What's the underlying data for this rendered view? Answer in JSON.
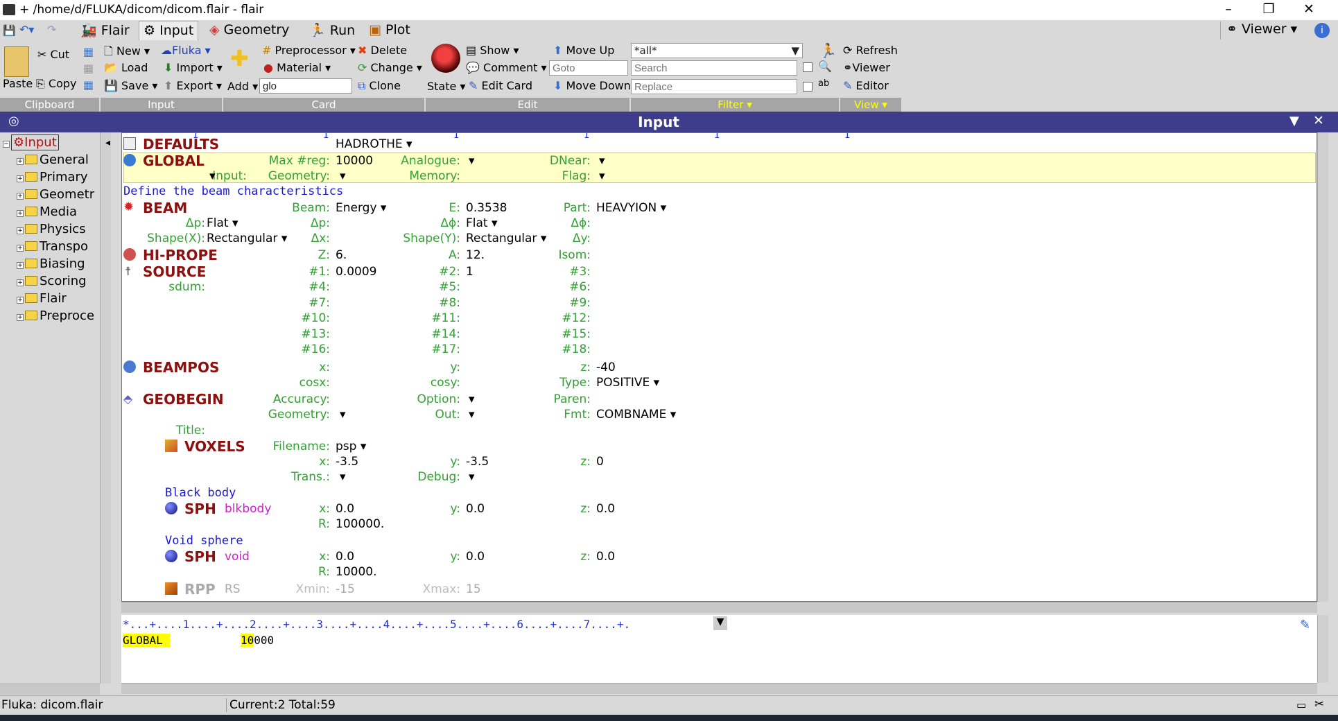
{
  "window": {
    "title": "+ /home/d/FLUKA/dicom/dicom.flair - flair"
  },
  "tabs": [
    {
      "label": "Flair"
    },
    {
      "label": "Input"
    },
    {
      "label": "Geometry"
    },
    {
      "label": "Run"
    },
    {
      "label": "Plot"
    }
  ],
  "viewer_menu": "Viewer",
  "ribbon": {
    "clipboard": {
      "cut": "Cut",
      "paste": "Paste",
      "copy": "Copy",
      "group": "Clipboard"
    },
    "input": {
      "new": "New",
      "load": "Load",
      "save": "Save",
      "fluka": "Fluka",
      "import": "Import",
      "export": "Export",
      "group": "Input"
    },
    "card": {
      "add": "Add",
      "add_value": "glo",
      "preprocessor": "Preprocessor",
      "material": "Material",
      "delete": "Delete",
      "change": "Change",
      "clone": "Clone",
      "group": "Card"
    },
    "edit": {
      "state": "State",
      "show": "Show",
      "comment": "Comment",
      "edit_card": "Edit Card",
      "move_up": "Move Up",
      "move_down": "Move Down",
      "goto_placeholder": "Goto",
      "group": "Edit"
    },
    "filter": {
      "select_value": "*all*",
      "search_placeholder": "Search",
      "replace_placeholder": "Replace",
      "group": "Filter"
    },
    "view": {
      "refresh": "Refresh",
      "viewer": "Viewer",
      "editor": "Editor",
      "group": "View"
    }
  },
  "panel": {
    "title": "Input"
  },
  "tree": {
    "root": "Input",
    "items": [
      "General",
      "Primary",
      "Geometr",
      "Media",
      "Physics",
      "Transpo",
      "Biasing",
      "Scoring",
      "Flair",
      "Preproce"
    ]
  },
  "ruler_top": [
    "1",
    "1",
    "1",
    "1",
    "1",
    "1"
  ],
  "cards": {
    "defaults": {
      "name": "DEFAULTS",
      "value": "HADROTHE"
    },
    "global": {
      "name": "GLOBAL",
      "maxreg_l": "Max #reg:",
      "maxreg": "10000",
      "analogue_l": "Analogue:",
      "dnear_l": "DNear:",
      "input_l": "Input:",
      "geometry_l": "Geometry:",
      "memory_l": "Memory:",
      "flag_l": "Flag:"
    },
    "beam_comment": "Define the beam characteristics",
    "beam": {
      "name": "BEAM",
      "beam_l": "Beam:",
      "beam": "Energy",
      "e_l": "E:",
      "e": "0.3538",
      "part_l": "Part:",
      "part": "HEAVYION",
      "dp_l": "Δp:",
      "dp": "Flat",
      "dphi_l": "Δϕ:",
      "dphi": "Flat",
      "dp_top_l": "Δp:",
      "dphi_top_l": "Δϕ:",
      "shapex_l": "Shape(X):",
      "shapex": "Rectangular",
      "shapey_l": "Shape(Y):",
      "shapey": "Rectangular",
      "dx_l": "Δx:",
      "dy_l": "Δy:"
    },
    "hiprope": {
      "name": "HI-PROPE",
      "z_l": "Z:",
      "z": "6.",
      "a_l": "A:",
      "a": "12.",
      "isom_l": "Isom:"
    },
    "source": {
      "name": "SOURCE",
      "sdum_l": "sdum:",
      "p1_l": "#1:",
      "p1": "0.0009",
      "p2_l": "#2:",
      "p2": "1",
      "p3_l": "#3:",
      "p4_l": "#4:",
      "p5_l": "#5:",
      "p6_l": "#6:",
      "p7_l": "#7:",
      "p8_l": "#8:",
      "p9_l": "#9:",
      "p10_l": "#10:",
      "p11_l": "#11:",
      "p12_l": "#12:",
      "p13_l": "#13:",
      "p14_l": "#14:",
      "p15_l": "#15:",
      "p16_l": "#16:",
      "p17_l": "#17:",
      "p18_l": "#18:"
    },
    "beampos": {
      "name": "BEAMPOS",
      "x_l": "x:",
      "y_l": "y:",
      "z_l": "z:",
      "z": "-40",
      "cosx_l": "cosx:",
      "cosy_l": "cosy:",
      "type_l": "Type:",
      "type": "POSITIVE"
    },
    "geobegin": {
      "name": "GEOBEGIN",
      "accuracy_l": "Accuracy:",
      "option_l": "Option:",
      "paren_l": "Paren:",
      "geometry_l": "Geometry:",
      "out_l": "Out:",
      "fmt_l": "Fmt:",
      "fmt": "COMBNAME"
    },
    "title_l": "Title:",
    "voxels": {
      "name": "VOXELS",
      "filename_l": "Filename:",
      "filename": "psp",
      "x_l": "x:",
      "x": "-3.5",
      "y_l": "y:",
      "y": "-3.5",
      "z_l": "z:",
      "z": "0",
      "trans_l": "Trans.:",
      "debug_l": "Debug:"
    },
    "blkbody_comment": "Black body",
    "sph1": {
      "name": "SPH",
      "id": "blkbody",
      "x_l": "x:",
      "x": "0.0",
      "y_l": "y:",
      "y": "0.0",
      "z_l": "z:",
      "z": "0.0",
      "r_l": "R:",
      "r": "100000."
    },
    "void_comment": "Void sphere",
    "sph2": {
      "name": "SPH",
      "id": "void",
      "x_l": "x:",
      "x": "0.0",
      "y_l": "y:",
      "y": "0.0",
      "z_l": "z:",
      "z": "0.0",
      "r_l": "R:",
      "r": "10000."
    },
    "rpp": {
      "name": "RPP",
      "id": "RS",
      "xmin_l": "Xmin:",
      "xmin": "-15",
      "xmax_l": "Xmax:",
      "xmax": "15"
    }
  },
  "editor": {
    "ruler": "*...+....1....+....2....+....3....+....4....+....5....+....6....+....7....+.",
    "line_card": "GLOBAL",
    "line_value_hl": "10",
    "line_value_rest": "000"
  },
  "status": {
    "file": "Fluka: dicom.flair",
    "counts": "Current:2  Total:59"
  },
  "colors": {
    "header_bg": "#3d3d8c",
    "card_name": "#8b1010",
    "label": "#35a035",
    "comment": "#1a1acc",
    "highlight": "#ffffc8",
    "editor_hl": "#ffff00",
    "filter_group": "#ffff00"
  }
}
